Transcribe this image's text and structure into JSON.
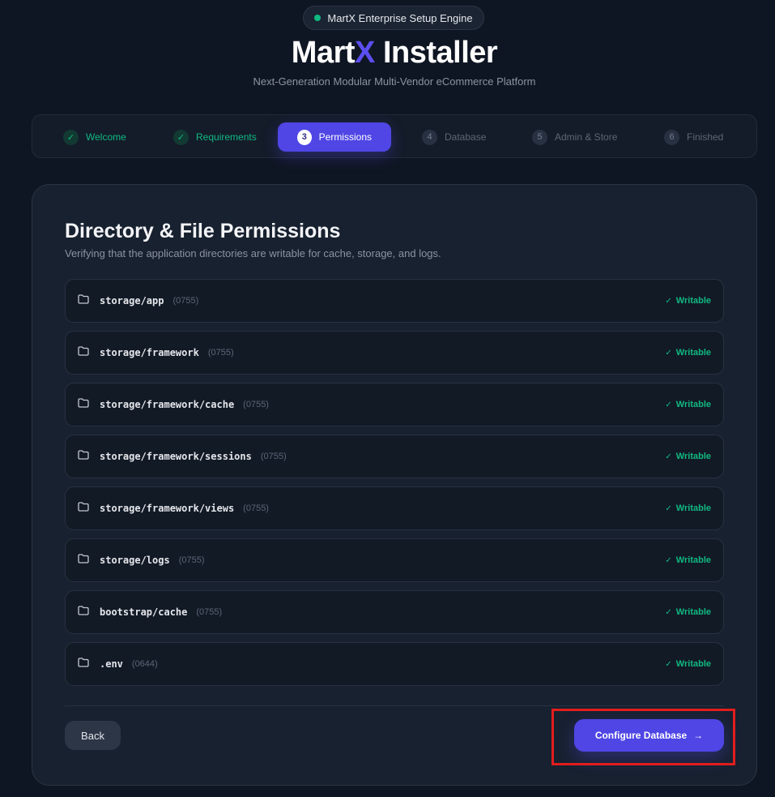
{
  "header": {
    "badge_text": "MartX Enterprise Setup Engine",
    "title_main": "Mart",
    "title_x": "X",
    "title_rest": " Installer",
    "subtitle": "Next-Generation Modular Multi-Vendor eCommerce Platform"
  },
  "steps": [
    {
      "marker": "✓",
      "label": "Welcome",
      "state": "done"
    },
    {
      "marker": "✓",
      "label": "Requirements",
      "state": "done"
    },
    {
      "marker": "3",
      "label": "Permissions",
      "state": "active"
    },
    {
      "marker": "4",
      "label": "Database",
      "state": "pending"
    },
    {
      "marker": "5",
      "label": "Admin & Store",
      "state": "pending"
    },
    {
      "marker": "6",
      "label": "Finished",
      "state": "pending"
    }
  ],
  "card": {
    "title": "Directory & File Permissions",
    "subtitle": "Verifying that the application directories are writable for cache, storage, and logs."
  },
  "permissions": [
    {
      "path": "storage/app",
      "mode": "(0755)",
      "status": "Writable"
    },
    {
      "path": "storage/framework",
      "mode": "(0755)",
      "status": "Writable"
    },
    {
      "path": "storage/framework/cache",
      "mode": "(0755)",
      "status": "Writable"
    },
    {
      "path": "storage/framework/sessions",
      "mode": "(0755)",
      "status": "Writable"
    },
    {
      "path": "storage/framework/views",
      "mode": "(0755)",
      "status": "Writable"
    },
    {
      "path": "storage/logs",
      "mode": "(0755)",
      "status": "Writable"
    },
    {
      "path": "bootstrap/cache",
      "mode": "(0755)",
      "status": "Writable"
    },
    {
      "path": ".env",
      "mode": "(0644)",
      "status": "Writable"
    }
  ],
  "actions": {
    "back_label": "Back",
    "next_label": "Configure Database",
    "next_arrow": "→"
  },
  "colors": {
    "accent": "#4f46e5",
    "success": "#10b981",
    "background": "#0f1623",
    "highlight": "#e11d1d"
  }
}
